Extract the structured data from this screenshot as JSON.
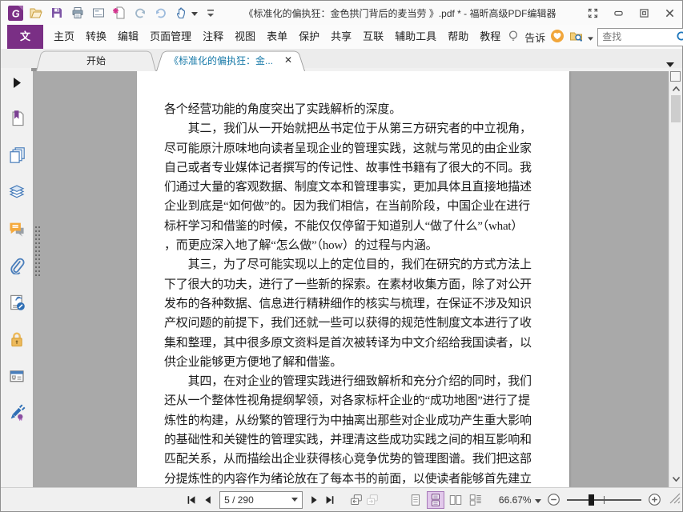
{
  "window": {
    "title": "《标准化的偏执狂：金色拱门背后的麦当劳 》.pdf * - 福昕高级PDF编辑器"
  },
  "quick_access": {
    "icons": [
      "foxit-logo",
      "open-file",
      "save",
      "print",
      "email",
      "create-pdf",
      "undo",
      "redo",
      "hand-tool",
      "customize-toolbar"
    ]
  },
  "menubar": {
    "items": [
      "文件",
      "主页",
      "转换",
      "编辑",
      "页面管理",
      "注释",
      "视图",
      "表单",
      "保护",
      "共享",
      "互联",
      "辅助工具",
      "帮助",
      "教程"
    ],
    "active_item": "文件",
    "tell_me_label": "告诉",
    "search_placeholder": "查找",
    "right_icons": [
      "lightbulb-icon",
      "heart-badge-icon",
      "folder-search-icon",
      "search-input",
      "gear-icon",
      "chevron-left-icon",
      "more-tools-button"
    ]
  },
  "tabbar": {
    "tabs": [
      {
        "label": "开始",
        "active": false
      },
      {
        "label": "《标准化的偏执狂：金...",
        "active": true
      }
    ]
  },
  "sidebar": {
    "icons": [
      "expand-panel",
      "bookmarks",
      "page-thumbnails",
      "layers",
      "comments",
      "attachments",
      "digital-signatures",
      "security",
      "form-fields",
      "sign"
    ]
  },
  "document": {
    "lines": [
      "各个经营功能的角度突出了实践解析的深度。",
      "　　其二，我们从一开始就把丛书定位于从第三方研究者的中立视角，",
      "尽可能原汁原味地向读者呈现企业的管理实践，这就与常见的由企业家",
      "自己或者专业媒体记者撰写的传记性、故事性书籍有了很大的不同。我",
      "们通过大量的客观数据、制度文本和管理事实，更加具体且直接地描述",
      "企业到底是“如何做”的。因为我们相信，在当前阶段，中国企业在进行",
      "标杆学习和借鉴的时候，不能仅仅停留于知道别人“做了什么”（what）",
      "，而更应深入地了解“怎么做”（how）的过程与内涵。",
      "　　其三，为了尽可能实现以上的定位目的，我们在研究的方式方法上",
      "下了很大的功夫，进行了一些新的探索。在素材收集方面，除了对公开",
      "发布的各种数据、信息进行精耕细作的核实与梳理，在保证不涉及知识",
      "产权问题的前提下，我们还就一些可以获得的规范性制度文本进行了收",
      "集和整理，其中很多原文资料是首次被转译为中文介绍给我国读者，以",
      "供企业能够更方便地了解和借鉴。",
      "　　其四，在对企业的管理实践进行细致解析和充分介绍的同时，我们",
      "还从一个整体性视角提纲挈领，对各家标杆企业的“成功地图”进行了提",
      "炼性的构建，从纷繁的管理行为中抽离出那些对企业成功产生重大影响",
      "的基础性和关键性的管理实践，并理清这些成功实践之间的相互影响和",
      "匹配关系，从而描绘出企业获得核心竞争优势的管理图谱。我们把这部",
      "分提炼性的内容作为绪论放在了每本书的前面，以使读者能够首先建立"
    ]
  },
  "statusbar": {
    "page_field": "5 / 290",
    "zoom_level": "66.67%"
  },
  "colors": {
    "accent_purple": "#7A2F85",
    "active_tab_text": "#1779A8",
    "doc_background": "#A9A9A9",
    "layout_active_bg": "#E2C9EB",
    "save_icon_purple": "#7D55A5",
    "comment_icon_orange": "#F5A93B"
  }
}
